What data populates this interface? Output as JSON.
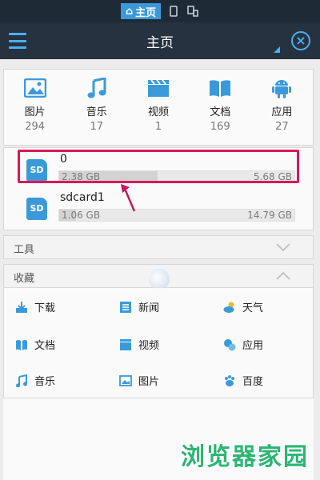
{
  "status_bar": {
    "home_tab_label": "主页"
  },
  "header": {
    "title": "主页"
  },
  "categories": [
    {
      "label": "图片",
      "count": "294",
      "icon": "image-icon"
    },
    {
      "label": "音乐",
      "count": "17",
      "icon": "music-icon"
    },
    {
      "label": "视频",
      "count": "1",
      "icon": "video-icon"
    },
    {
      "label": "文档",
      "count": "169",
      "icon": "document-icon"
    },
    {
      "label": "应用",
      "count": "27",
      "icon": "android-icon"
    }
  ],
  "drives": [
    {
      "badge": "SD",
      "name": "0",
      "used": "2.38 GB",
      "total": "5.68 GB",
      "used_fraction": 0.42
    },
    {
      "badge": "SD",
      "name": "sdcard1",
      "used": "1.06 GB",
      "total": "14.79 GB",
      "used_fraction": 0.07
    }
  ],
  "sections": {
    "tools": "工具",
    "favorites": "收藏"
  },
  "favorites": [
    {
      "label": "下载",
      "icon": "download-icon"
    },
    {
      "label": "新闻",
      "icon": "news-icon"
    },
    {
      "label": "天气",
      "icon": "weather-icon"
    },
    {
      "label": "文档",
      "icon": "document-icon"
    },
    {
      "label": "视频",
      "icon": "video-icon"
    },
    {
      "label": "应用",
      "icon": "app-icon"
    },
    {
      "label": "音乐",
      "icon": "music-icon"
    },
    {
      "label": "图片",
      "icon": "image-icon"
    },
    {
      "label": "百度",
      "icon": "baidu-icon"
    }
  ],
  "watermark": "浏览器家园",
  "colors": {
    "accent": "#3a9ad9",
    "highlight": "#d8185a",
    "annotation_arrow": "#c2185b"
  }
}
